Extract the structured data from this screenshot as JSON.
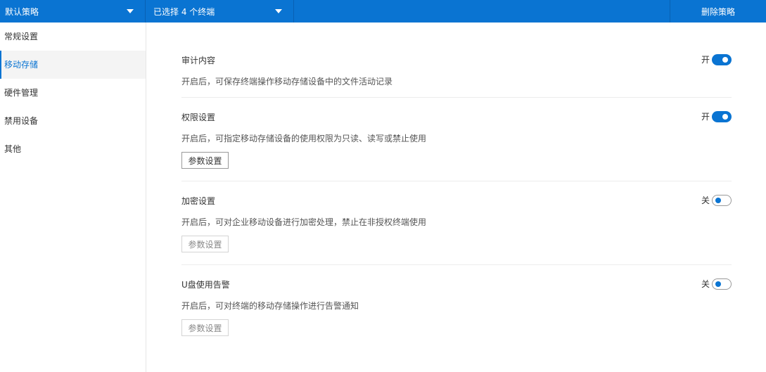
{
  "topbar": {
    "policy_select": "默认策略",
    "terminal_select": "已选择 4 个终端",
    "delete_label": "删除策略"
  },
  "sidebar": {
    "items": [
      {
        "label": "常规设置"
      },
      {
        "label": "移动存储"
      },
      {
        "label": "硬件管理"
      },
      {
        "label": "禁用设备"
      },
      {
        "label": "其他"
      }
    ],
    "active_index": 1
  },
  "sections": [
    {
      "title": "审计内容",
      "state_label": "开",
      "enabled": true,
      "description": "开启后，可保存终端操作移动存储设备中的文件活动记录"
    },
    {
      "title": "权限设置",
      "state_label": "开",
      "enabled": true,
      "description": "开启后，可指定移动存储设备的使用权限为只读、读写或禁止使用",
      "button_label": "参数设置"
    },
    {
      "title": "加密设置",
      "state_label": "关",
      "enabled": false,
      "description": "开启后，可对企业移动设备进行加密处理，禁止在非授权终端使用",
      "button_label": "参数设置"
    },
    {
      "title": "U盘使用告警",
      "state_label": "关",
      "enabled": false,
      "description": "开启后，可对终端的移动存储操作进行告警通知",
      "button_label": "参数设置"
    }
  ],
  "colors": {
    "accent": "#0a74d2",
    "active_nav_bg": "#f4f4f4",
    "divider": "#ececec"
  }
}
